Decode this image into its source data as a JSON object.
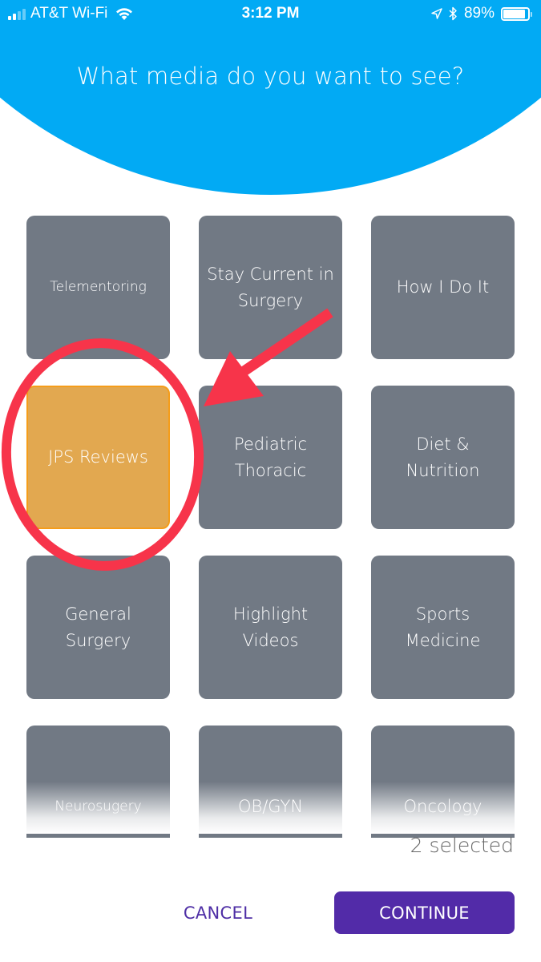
{
  "status_bar": {
    "carrier": "AT&T Wi-Fi",
    "time": "3:12 PM",
    "battery_percent": "89%",
    "battery_level": 0.89,
    "signal_bars_filled": 2,
    "signal_bars_total": 4,
    "icons": [
      "signal-icon",
      "wifi-icon",
      "location-icon",
      "bluetooth-icon",
      "battery-icon"
    ]
  },
  "header": {
    "title": "What media do you want to see?",
    "color": "#02AAF4"
  },
  "tiles": [
    {
      "label": "Telementoring",
      "selected": false
    },
    {
      "label": "Stay Current in Surgery",
      "selected": false
    },
    {
      "label": "How I Do It",
      "selected": false
    },
    {
      "label": "JPS Reviews",
      "selected": true
    },
    {
      "label": "Pediatric Thoracic",
      "selected": false
    },
    {
      "label": "Diet & Nutrition",
      "selected": false
    },
    {
      "label": "General Surgery",
      "selected": false
    },
    {
      "label": "Highlight Videos",
      "selected": false
    },
    {
      "label": "Sports Medicine",
      "selected": false
    },
    {
      "label": "Neurosugery",
      "selected": false
    },
    {
      "label": "OB/GYN",
      "selected": false
    },
    {
      "label": "Oncology",
      "selected": false
    }
  ],
  "colors": {
    "tile_default": "#717984",
    "tile_selected": "#E2A850",
    "tile_selected_border": "#F59D1A",
    "primary_button": "#522BA8",
    "annotation_red": "#F7344A"
  },
  "footer": {
    "selected_count": "2 selected",
    "cancel_label": "CANCEL",
    "continue_label": "CONTINUE"
  },
  "annotations": {
    "circle_target": "JPS Reviews",
    "arrow_target": "JPS Reviews"
  }
}
